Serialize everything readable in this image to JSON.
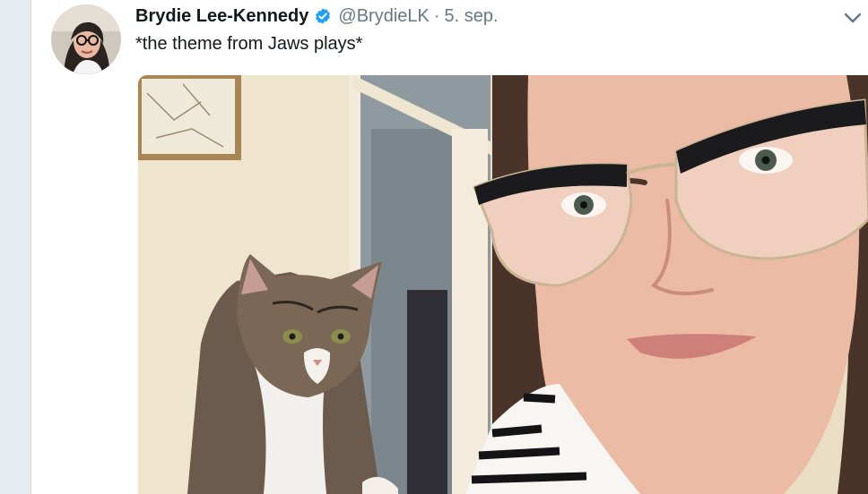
{
  "tweet": {
    "display_name": "Brydie Lee-Kennedy",
    "handle": "@BrydieLK",
    "separator": "·",
    "date": "5. sep.",
    "text": "*the theme from Jaws plays*",
    "verified": true,
    "accent_color": "#1da1f2"
  },
  "icons": {
    "verified": "verified-badge-icon",
    "caret": "chevron-down-icon"
  },
  "media": {
    "subject": "selfie photo"
  }
}
